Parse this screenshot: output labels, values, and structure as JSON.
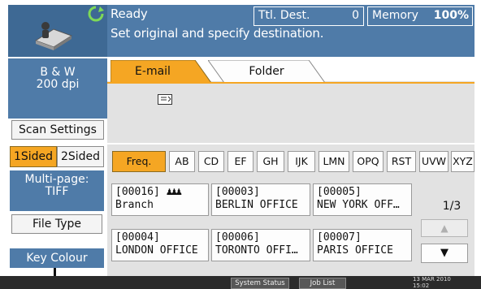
{
  "header": {
    "status_line1": "Ready",
    "status_line2": "Set original and specify destination.",
    "ttl_dest_label": "Ttl. Dest.",
    "ttl_dest_count": "0",
    "memory_label": "Memory",
    "memory_value": "100%"
  },
  "sidebar": {
    "mode": "B & W",
    "resolution": "200 dpi",
    "scan_settings": "Scan Settings",
    "sided_1": "1Sided",
    "sided_2": "2Sided",
    "multipage_line1": "Multi-page:",
    "multipage_line2": "TIFF",
    "file_type": "File Type",
    "key_colour": "Key Colour"
  },
  "tabs": {
    "email": "E-mail",
    "folder": "Folder"
  },
  "index_tabs": [
    "Freq.",
    "AB",
    "CD",
    "EF",
    "GH",
    "IJK",
    "LMN",
    "OPQ",
    "RST",
    "UVW",
    "XYZ"
  ],
  "destinations": [
    {
      "id": "[00016]",
      "name": "Branch",
      "group": true
    },
    {
      "id": "[00003]",
      "name": "BERLIN OFFICE"
    },
    {
      "id": "[00005]",
      "name": "NEW YORK OFF…"
    },
    {
      "id": "[00004]",
      "name": "LONDON OFFICE"
    },
    {
      "id": "[00006]",
      "name": "TORONTO OFFI…"
    },
    {
      "id": "[00007]",
      "name": "PARIS OFFICE"
    }
  ],
  "pager": {
    "page": "1/3",
    "up": "▲",
    "down": "▼"
  },
  "statusbar": {
    "system_status": "System Status",
    "job_list": "Job List",
    "date": "13 MAR  2010",
    "time": "15:02"
  },
  "colors": {
    "header_blue": "#4f7ba8",
    "tab_active": "#f5a623",
    "index_active": "#f5a623"
  }
}
